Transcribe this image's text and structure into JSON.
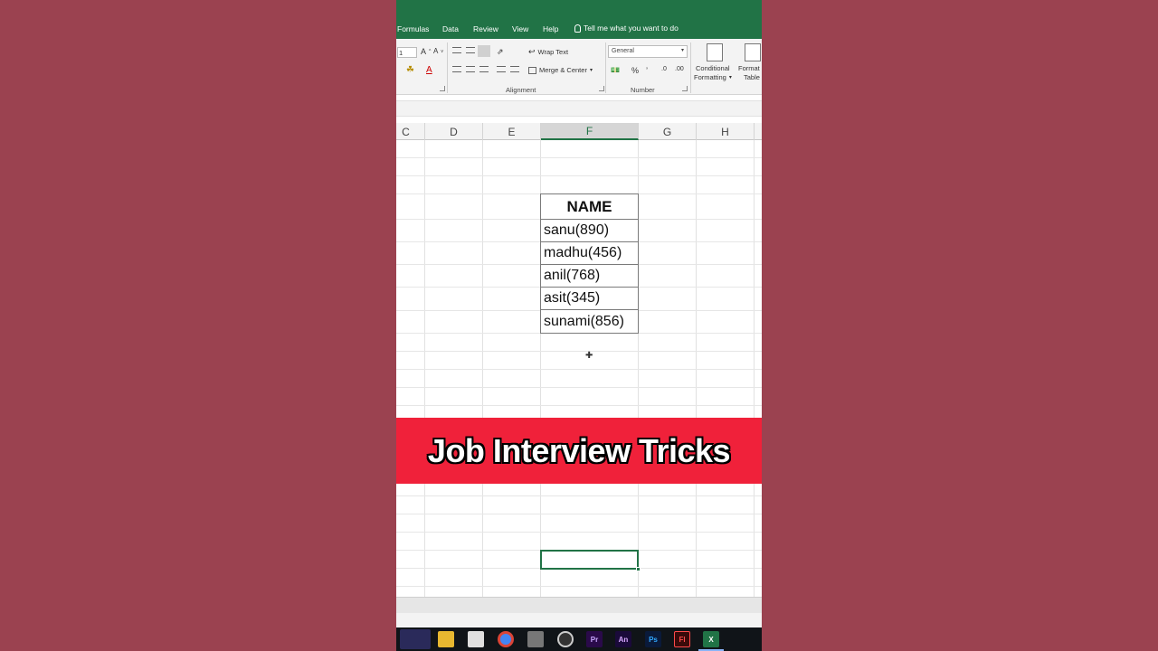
{
  "menubar": {
    "tabs": [
      "Formulas",
      "Data",
      "Review",
      "View",
      "Help"
    ],
    "tell_me": "Tell me what you want to do"
  },
  "ribbon": {
    "font_size": "1",
    "wrap_text": "Wrap Text",
    "merge_center": "Merge & Center",
    "number_format": "General",
    "percent": "%",
    "comma": "’",
    "conditional_formatting_1": "Conditional",
    "conditional_formatting_2": "Formatting",
    "format_table_1": "Format",
    "format_table_2": "Table",
    "groups": {
      "alignment": "Alignment",
      "number": "Number"
    }
  },
  "columns": [
    "C",
    "D",
    "E",
    "F",
    "G",
    "H"
  ],
  "selected_column": "F",
  "table": {
    "header": "NAME",
    "rows": [
      "sanu(890)",
      "madhu(456)",
      "anil(768)",
      "asit(345)",
      "sunami(856)"
    ]
  },
  "banner": {
    "text": "Job Interview Tricks"
  },
  "taskbar": {
    "items": [
      {
        "name": "start",
        "label": "",
        "color": "#3a2a6a"
      },
      {
        "name": "file-explorer",
        "label": "",
        "color": "#f0c040"
      },
      {
        "name": "store",
        "label": "",
        "color": "#ffffff"
      },
      {
        "name": "chrome",
        "label": "",
        "color": "#4285f4"
      },
      {
        "name": "app",
        "label": "",
        "color": "#888888"
      },
      {
        "name": "recorder",
        "label": "",
        "color": "#444444"
      },
      {
        "name": "premiere",
        "label": "Pr",
        "color": "#2a0a4a"
      },
      {
        "name": "animate",
        "label": "An",
        "color": "#1a0a3a"
      },
      {
        "name": "photoshop",
        "label": "Ps",
        "color": "#0a1a3a"
      },
      {
        "name": "flash",
        "label": "Fl",
        "color": "#3a0a0a"
      },
      {
        "name": "excel",
        "label": "X",
        "color": "#217346"
      }
    ]
  },
  "colors": {
    "excel_green": "#217346",
    "banner_red": "#f0213a",
    "background": "#9c4351"
  }
}
